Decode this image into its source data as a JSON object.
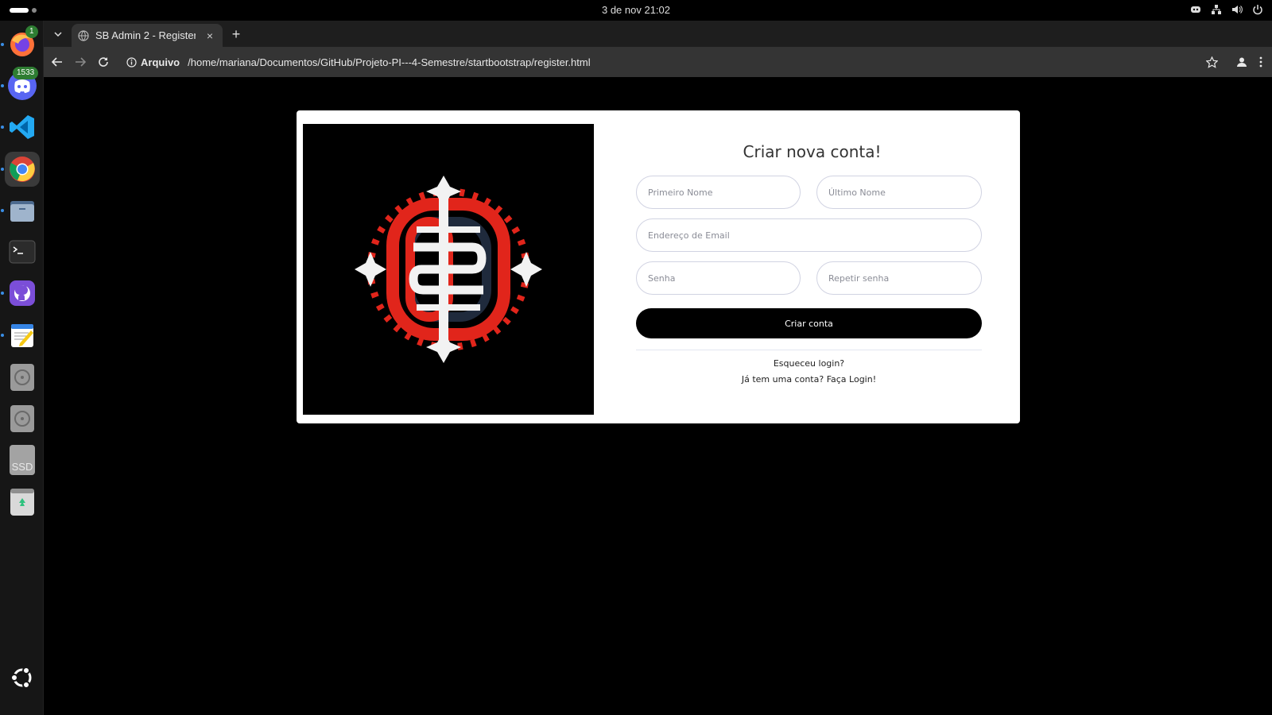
{
  "system": {
    "clock": "3 de nov  21:02"
  },
  "dock": {
    "items": [
      {
        "name": "firefox",
        "badge": "1"
      },
      {
        "name": "discord",
        "badge": "1533"
      },
      {
        "name": "vscode"
      },
      {
        "name": "chrome"
      },
      {
        "name": "files"
      },
      {
        "name": "terminal"
      },
      {
        "name": "github-desktop"
      },
      {
        "name": "text-editor"
      },
      {
        "name": "disk-1"
      },
      {
        "name": "disk-2"
      },
      {
        "name": "ssd",
        "label": "SSD"
      },
      {
        "name": "trash"
      },
      {
        "name": "ubuntu"
      }
    ]
  },
  "browser": {
    "tab_title": "SB Admin 2 - Register",
    "tab_close": "×",
    "new_tab": "+",
    "security_chip": "Arquivo",
    "url": "/home/mariana/Documentos/GitHub/Projeto-PI---4-Semestre/startbootstrap/register.html"
  },
  "form": {
    "title": "Criar nova conta!",
    "first_name": {
      "placeholder": "Primeiro Nome",
      "value": ""
    },
    "last_name": {
      "placeholder": "Último Nome",
      "value": ""
    },
    "email": {
      "placeholder": "Endereço de Email",
      "value": ""
    },
    "password": {
      "placeholder": "Senha",
      "value": ""
    },
    "repeat_password": {
      "placeholder": "Repetir senha",
      "value": ""
    },
    "submit_label": "Criar conta",
    "forgot_link": "Esqueceu login?",
    "login_link": "Já tem uma conta? Faça Login!"
  },
  "colors": {
    "brand_red": "#e1251b",
    "brand_navy": "#1f2a3c",
    "button": "#000000",
    "page_bg": "#000000"
  }
}
